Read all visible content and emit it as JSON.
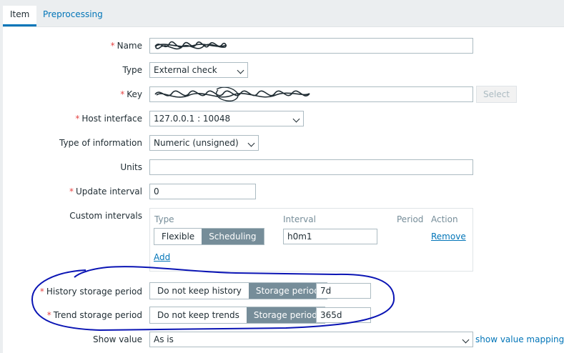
{
  "tabs": [
    {
      "label": "Item",
      "active": true
    },
    {
      "label": "Preprocessing",
      "active": false
    }
  ],
  "form": {
    "name": {
      "label": "Name",
      "required": true,
      "value_redacted": true
    },
    "type": {
      "label": "Type",
      "value": "External check"
    },
    "key": {
      "label": "Key",
      "required": true,
      "value_redacted": true,
      "select_label": "Select"
    },
    "host_interface": {
      "label": "Host interface",
      "required": true,
      "value": "127.0.0.1 : 10048"
    },
    "type_of_information": {
      "label": "Type of information",
      "value": "Numeric (unsigned)"
    },
    "units": {
      "label": "Units",
      "value": ""
    },
    "update_interval": {
      "label": "Update interval",
      "required": true,
      "value": "0"
    },
    "custom_intervals": {
      "label": "Custom intervals",
      "headers": {
        "type": "Type",
        "interval": "Interval",
        "period": "Period",
        "action": "Action"
      },
      "row": {
        "flexible": "Flexible",
        "scheduling": "Scheduling",
        "selected": "Scheduling",
        "interval": "h0m1",
        "remove": "Remove"
      },
      "add": "Add"
    },
    "history": {
      "label": "History storage period",
      "required": true,
      "option_off": "Do not keep history",
      "option_on": "Storage period",
      "selected": "Storage period",
      "value": "7d"
    },
    "trend": {
      "label": "Trend storage period",
      "required": true,
      "option_off": "Do not keep trends",
      "option_on": "Storage period",
      "selected": "Storage period",
      "value": "365d"
    },
    "show_value": {
      "label": "Show value",
      "value": "As is",
      "link": "show value mappings"
    }
  },
  "colors": {
    "accent": "#0275b8",
    "required": "#e54545",
    "segment_on": "#768d99",
    "annotation": "#0a14b4"
  }
}
